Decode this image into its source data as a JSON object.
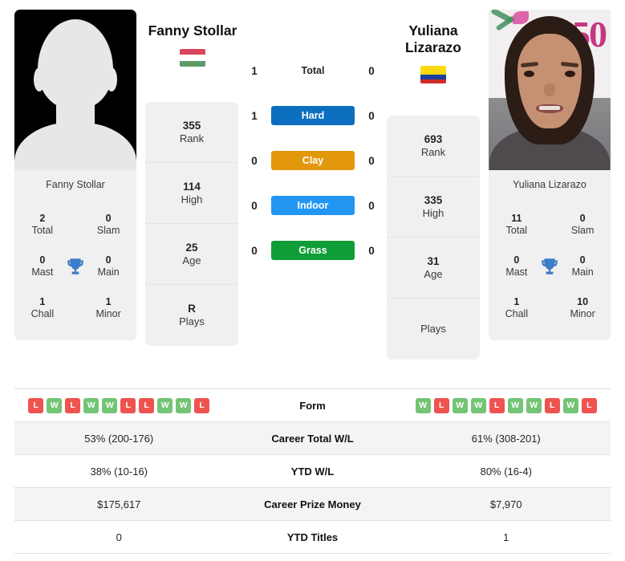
{
  "players": {
    "left": {
      "name": "Fanny Stollar",
      "country_flag": "hungary-flag",
      "photo_type": "silhouette-placeholder",
      "photo_caption": "Fanny Stollar",
      "stats": [
        {
          "value": "355",
          "label": "Rank"
        },
        {
          "value": "114",
          "label": "High"
        },
        {
          "value": "25",
          "label": "Age"
        },
        {
          "value": "R",
          "label": "Plays"
        }
      ],
      "titles": {
        "total": "2",
        "slam": "0",
        "mast": "0",
        "main": "0",
        "chall": "1",
        "minor": "1"
      },
      "h2h": [
        "1",
        "1",
        "0",
        "0",
        "0"
      ],
      "form": [
        "L",
        "W",
        "L",
        "W",
        "W",
        "L",
        "L",
        "W",
        "W",
        "L"
      ],
      "career_total_wl": "53% (200-176)",
      "ytd_wl": "38% (10-16)",
      "career_prize_money": "$175,617",
      "ytd_titles": "0"
    },
    "right": {
      "name_line1": "Yuliana",
      "name_line2": "Lizarazo",
      "country_flag": "colombia-flag",
      "photo_type": "portrait-photo",
      "photo_caption": "Yuliana Lizarazo",
      "stats": [
        {
          "value": "693",
          "label": "Rank"
        },
        {
          "value": "335",
          "label": "High"
        },
        {
          "value": "31",
          "label": "Age"
        },
        {
          "value": "",
          "label": "Plays"
        }
      ],
      "titles": {
        "total": "11",
        "slam": "0",
        "mast": "0",
        "main": "0",
        "chall": "1",
        "minor": "10"
      },
      "h2h": [
        "0",
        "0",
        "0",
        "0",
        "0"
      ],
      "form": [
        "W",
        "L",
        "W",
        "W",
        "L",
        "W",
        "W",
        "L",
        "W",
        "L"
      ],
      "career_total_wl": "61% (308-201)",
      "ytd_wl": "80% (16-4)",
      "career_prize_money": "$7,970",
      "ytd_titles": "1"
    }
  },
  "trophy_labels": {
    "total": "Total",
    "slam": "Slam",
    "mast": "Mast",
    "main": "Main",
    "chall": "Chall",
    "minor": "Minor"
  },
  "h2h_rows": [
    {
      "label": "Total",
      "type": "plain",
      "color": ""
    },
    {
      "label": "Hard",
      "type": "badge",
      "color": "#0c6ebf"
    },
    {
      "label": "Clay",
      "type": "badge",
      "color": "#e2970c"
    },
    {
      "label": "Indoor",
      "type": "badge",
      "color": "#2196f3"
    },
    {
      "label": "Grass",
      "type": "badge",
      "color": "#0f9d38"
    }
  ],
  "table": {
    "rows": [
      {
        "label": "Form",
        "key": "form"
      },
      {
        "label": "Career Total W/L",
        "key": "career_total_wl"
      },
      {
        "label": "YTD W/L",
        "key": "ytd_wl"
      },
      {
        "label": "Career Prize Money",
        "key": "career_prize_money"
      },
      {
        "label": "YTD Titles",
        "key": "ytd_titles"
      }
    ]
  },
  "colors": {
    "panel_bg": "#f0f0f0",
    "win": "#74c476",
    "loss": "#ef5350",
    "hard": "#0c6ebf",
    "clay": "#e2970c",
    "indoor": "#2196f3",
    "grass": "#0f9d38"
  }
}
